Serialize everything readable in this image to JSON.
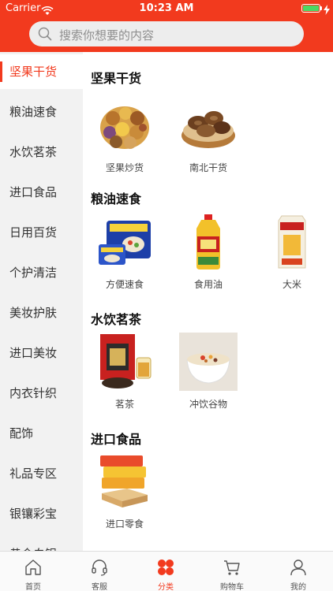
{
  "status_bar": {
    "carrier": "Carrier",
    "time": "10:23 AM"
  },
  "search": {
    "placeholder": "搜索你想要的内容"
  },
  "colors": {
    "accent": "#f23a1e",
    "sidebar_bg": "#f2f2f2"
  },
  "sidebar": {
    "items": [
      {
        "label": "坚果干货",
        "active": true
      },
      {
        "label": "粮油速食"
      },
      {
        "label": "水饮茗茶"
      },
      {
        "label": "进口食品"
      },
      {
        "label": "日用百货"
      },
      {
        "label": "个护清洁"
      },
      {
        "label": "美妆护肤"
      },
      {
        "label": "进口美妆"
      },
      {
        "label": "内衣针织"
      },
      {
        "label": "配饰"
      },
      {
        "label": "礼品专区"
      },
      {
        "label": "银镶彩宝"
      },
      {
        "label": "黄金白银"
      }
    ]
  },
  "sections": [
    {
      "title": "坚果干货",
      "products": [
        {
          "name": "坚果炒货",
          "icon": "mixed-nuts"
        },
        {
          "name": "南北干货",
          "icon": "dried-mushrooms"
        }
      ]
    },
    {
      "title": "粮油速食",
      "products": [
        {
          "name": "方便速食",
          "icon": "instant-noodles"
        },
        {
          "name": "食用油",
          "icon": "oil-bottle"
        },
        {
          "name": "大米",
          "icon": "rice-bag"
        }
      ]
    },
    {
      "title": "水饮茗茶",
      "products": [
        {
          "name": "茗茶",
          "icon": "tea-box"
        },
        {
          "name": "冲饮谷物",
          "icon": "cereal-bowl"
        }
      ]
    },
    {
      "title": "进口食品",
      "products": [
        {
          "name": "进口零食",
          "icon": "wafer-snacks"
        }
      ]
    }
  ],
  "tabbar": {
    "tabs": [
      {
        "label": "首页",
        "icon": "home-icon"
      },
      {
        "label": "客服",
        "icon": "headset-icon"
      },
      {
        "label": "分类",
        "icon": "category-icon",
        "active": true
      },
      {
        "label": "购物车",
        "icon": "cart-icon"
      },
      {
        "label": "我的",
        "icon": "profile-icon"
      }
    ]
  }
}
